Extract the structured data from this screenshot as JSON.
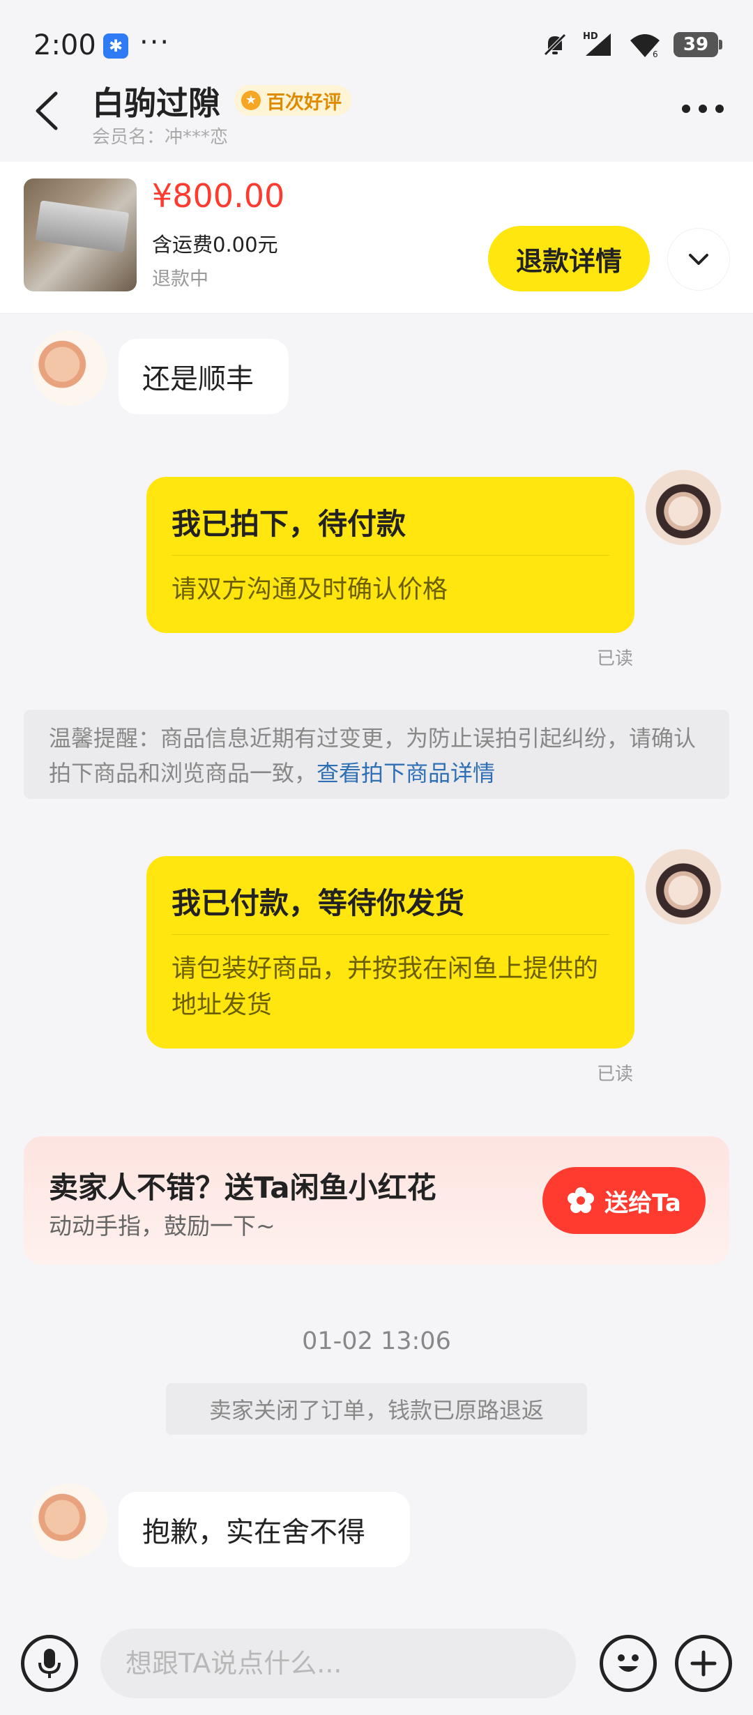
{
  "status_bar": {
    "time": "2:00",
    "app_icon": "chat-app-icon",
    "dots": "···",
    "battery": "39",
    "hd_label": "HD",
    "signal_sub": "6"
  },
  "header": {
    "seller_name": "白驹过隙",
    "badge": "百次好评",
    "member_name": "会员名：冲***恋"
  },
  "product": {
    "price": "¥800.00",
    "shipping": "含运费0.00元",
    "status": "退款中",
    "refund_button": "退款详情"
  },
  "messages": {
    "msg1": "还是顺丰",
    "card1": {
      "title": "我已拍下，待付款",
      "body": "请双方沟通及时确认价格",
      "read": "已读"
    },
    "notice": {
      "text": "温馨提醒：商品信息近期有过变更，为防止误拍引起纠纷，请确认拍下商品和浏览商品一致，",
      "link": "查看拍下商品详情"
    },
    "card2": {
      "title": "我已付款，等待你发货",
      "body": "请包装好商品，并按我在闲鱼上提供的地址发货",
      "read": "已读"
    },
    "promo": {
      "title": "卖家人不错？送Ta闲鱼小红花",
      "subtitle": "动动手指，鼓励一下~",
      "button": "送给Ta"
    },
    "timestamp": "01-02 13:06",
    "system": "卖家关闭了订单，钱款已原路退返",
    "msg2": "抱歉，实在舍不得"
  },
  "input": {
    "placeholder": "想跟TA说点什么..."
  },
  "colors": {
    "accent_yellow": "#ffe60f",
    "price_red": "#ff3b30",
    "link_blue": "#2f6fb5"
  }
}
